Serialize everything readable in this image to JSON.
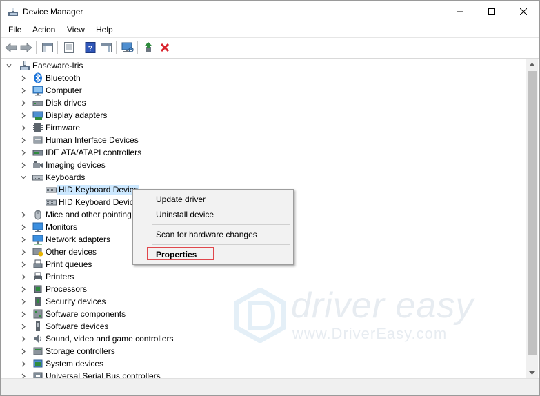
{
  "window": {
    "title": "Device Manager"
  },
  "menu": [
    "File",
    "Action",
    "View",
    "Help"
  ],
  "tree": {
    "root": "Easeware-Iris",
    "items": [
      {
        "label": "Bluetooth",
        "icon": "bluetooth-icon"
      },
      {
        "label": "Computer",
        "icon": "computer-icon"
      },
      {
        "label": "Disk drives",
        "icon": "disk-drive-icon"
      },
      {
        "label": "Display adapters",
        "icon": "display-adapter-icon"
      },
      {
        "label": "Firmware",
        "icon": "firmware-icon"
      },
      {
        "label": "Human Interface Devices",
        "icon": "hid-icon"
      },
      {
        "label": "IDE ATA/ATAPI controllers",
        "icon": "ide-controller-icon"
      },
      {
        "label": "Imaging devices",
        "icon": "camera-icon"
      },
      {
        "label": "Keyboards",
        "icon": "keyboard-icon",
        "expanded": true,
        "children": [
          {
            "label": "HID Keyboard Device",
            "icon": "keyboard-icon",
            "selected": true
          },
          {
            "label": "HID Keyboard Device",
            "icon": "keyboard-icon"
          }
        ]
      },
      {
        "label": "Mice and other pointing devices",
        "icon": "mouse-icon"
      },
      {
        "label": "Monitors",
        "icon": "monitor-icon"
      },
      {
        "label": "Network adapters",
        "icon": "network-adapter-icon"
      },
      {
        "label": "Other devices",
        "icon": "other-devices-icon"
      },
      {
        "label": "Print queues",
        "icon": "print-queue-icon"
      },
      {
        "label": "Printers",
        "icon": "printer-icon"
      },
      {
        "label": "Processors",
        "icon": "processor-icon"
      },
      {
        "label": "Security devices",
        "icon": "security-device-icon"
      },
      {
        "label": "Software components",
        "icon": "software-component-icon"
      },
      {
        "label": "Software devices",
        "icon": "software-device-icon"
      },
      {
        "label": "Sound, video and game controllers",
        "icon": "sound-icon"
      },
      {
        "label": "Storage controllers",
        "icon": "storage-controller-icon"
      },
      {
        "label": "System devices",
        "icon": "system-device-icon"
      },
      {
        "label": "Universal Serial Bus controllers",
        "icon": "usb-icon"
      }
    ]
  },
  "context_menu": {
    "update": "Update driver",
    "uninstall": "Uninstall device",
    "scan": "Scan for hardware changes",
    "properties": "Properties",
    "highlight_color": "#e0474c"
  },
  "watermark": {
    "brand": "driver easy",
    "url": "www.DriverEasy.com"
  },
  "colors": {
    "selection": "#cce8ff",
    "accent_green": "#2e8b3d",
    "accent_red": "#d9232d"
  }
}
